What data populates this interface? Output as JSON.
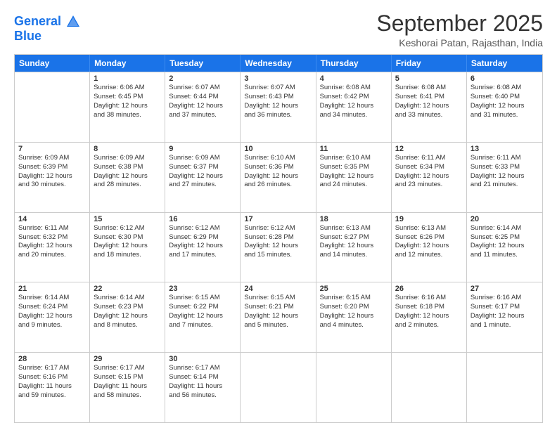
{
  "logo": {
    "line1": "General",
    "line2": "Blue"
  },
  "title": "September 2025",
  "subtitle": "Keshorai Patan, Rajasthan, India",
  "headers": [
    "Sunday",
    "Monday",
    "Tuesday",
    "Wednesday",
    "Thursday",
    "Friday",
    "Saturday"
  ],
  "rows": [
    [
      {
        "day": "",
        "lines": []
      },
      {
        "day": "1",
        "lines": [
          "Sunrise: 6:06 AM",
          "Sunset: 6:45 PM",
          "Daylight: 12 hours",
          "and 38 minutes."
        ]
      },
      {
        "day": "2",
        "lines": [
          "Sunrise: 6:07 AM",
          "Sunset: 6:44 PM",
          "Daylight: 12 hours",
          "and 37 minutes."
        ]
      },
      {
        "day": "3",
        "lines": [
          "Sunrise: 6:07 AM",
          "Sunset: 6:43 PM",
          "Daylight: 12 hours",
          "and 36 minutes."
        ]
      },
      {
        "day": "4",
        "lines": [
          "Sunrise: 6:08 AM",
          "Sunset: 6:42 PM",
          "Daylight: 12 hours",
          "and 34 minutes."
        ]
      },
      {
        "day": "5",
        "lines": [
          "Sunrise: 6:08 AM",
          "Sunset: 6:41 PM",
          "Daylight: 12 hours",
          "and 33 minutes."
        ]
      },
      {
        "day": "6",
        "lines": [
          "Sunrise: 6:08 AM",
          "Sunset: 6:40 PM",
          "Daylight: 12 hours",
          "and 31 minutes."
        ]
      }
    ],
    [
      {
        "day": "7",
        "lines": [
          "Sunrise: 6:09 AM",
          "Sunset: 6:39 PM",
          "Daylight: 12 hours",
          "and 30 minutes."
        ]
      },
      {
        "day": "8",
        "lines": [
          "Sunrise: 6:09 AM",
          "Sunset: 6:38 PM",
          "Daylight: 12 hours",
          "and 28 minutes."
        ]
      },
      {
        "day": "9",
        "lines": [
          "Sunrise: 6:09 AM",
          "Sunset: 6:37 PM",
          "Daylight: 12 hours",
          "and 27 minutes."
        ]
      },
      {
        "day": "10",
        "lines": [
          "Sunrise: 6:10 AM",
          "Sunset: 6:36 PM",
          "Daylight: 12 hours",
          "and 26 minutes."
        ]
      },
      {
        "day": "11",
        "lines": [
          "Sunrise: 6:10 AM",
          "Sunset: 6:35 PM",
          "Daylight: 12 hours",
          "and 24 minutes."
        ]
      },
      {
        "day": "12",
        "lines": [
          "Sunrise: 6:11 AM",
          "Sunset: 6:34 PM",
          "Daylight: 12 hours",
          "and 23 minutes."
        ]
      },
      {
        "day": "13",
        "lines": [
          "Sunrise: 6:11 AM",
          "Sunset: 6:33 PM",
          "Daylight: 12 hours",
          "and 21 minutes."
        ]
      }
    ],
    [
      {
        "day": "14",
        "lines": [
          "Sunrise: 6:11 AM",
          "Sunset: 6:32 PM",
          "Daylight: 12 hours",
          "and 20 minutes."
        ]
      },
      {
        "day": "15",
        "lines": [
          "Sunrise: 6:12 AM",
          "Sunset: 6:30 PM",
          "Daylight: 12 hours",
          "and 18 minutes."
        ]
      },
      {
        "day": "16",
        "lines": [
          "Sunrise: 6:12 AM",
          "Sunset: 6:29 PM",
          "Daylight: 12 hours",
          "and 17 minutes."
        ]
      },
      {
        "day": "17",
        "lines": [
          "Sunrise: 6:12 AM",
          "Sunset: 6:28 PM",
          "Daylight: 12 hours",
          "and 15 minutes."
        ]
      },
      {
        "day": "18",
        "lines": [
          "Sunrise: 6:13 AM",
          "Sunset: 6:27 PM",
          "Daylight: 12 hours",
          "and 14 minutes."
        ]
      },
      {
        "day": "19",
        "lines": [
          "Sunrise: 6:13 AM",
          "Sunset: 6:26 PM",
          "Daylight: 12 hours",
          "and 12 minutes."
        ]
      },
      {
        "day": "20",
        "lines": [
          "Sunrise: 6:14 AM",
          "Sunset: 6:25 PM",
          "Daylight: 12 hours",
          "and 11 minutes."
        ]
      }
    ],
    [
      {
        "day": "21",
        "lines": [
          "Sunrise: 6:14 AM",
          "Sunset: 6:24 PM",
          "Daylight: 12 hours",
          "and 9 minutes."
        ]
      },
      {
        "day": "22",
        "lines": [
          "Sunrise: 6:14 AM",
          "Sunset: 6:23 PM",
          "Daylight: 12 hours",
          "and 8 minutes."
        ]
      },
      {
        "day": "23",
        "lines": [
          "Sunrise: 6:15 AM",
          "Sunset: 6:22 PM",
          "Daylight: 12 hours",
          "and 7 minutes."
        ]
      },
      {
        "day": "24",
        "lines": [
          "Sunrise: 6:15 AM",
          "Sunset: 6:21 PM",
          "Daylight: 12 hours",
          "and 5 minutes."
        ]
      },
      {
        "day": "25",
        "lines": [
          "Sunrise: 6:15 AM",
          "Sunset: 6:20 PM",
          "Daylight: 12 hours",
          "and 4 minutes."
        ]
      },
      {
        "day": "26",
        "lines": [
          "Sunrise: 6:16 AM",
          "Sunset: 6:18 PM",
          "Daylight: 12 hours",
          "and 2 minutes."
        ]
      },
      {
        "day": "27",
        "lines": [
          "Sunrise: 6:16 AM",
          "Sunset: 6:17 PM",
          "Daylight: 12 hours",
          "and 1 minute."
        ]
      }
    ],
    [
      {
        "day": "28",
        "lines": [
          "Sunrise: 6:17 AM",
          "Sunset: 6:16 PM",
          "Daylight: 11 hours",
          "and 59 minutes."
        ]
      },
      {
        "day": "29",
        "lines": [
          "Sunrise: 6:17 AM",
          "Sunset: 6:15 PM",
          "Daylight: 11 hours",
          "and 58 minutes."
        ]
      },
      {
        "day": "30",
        "lines": [
          "Sunrise: 6:17 AM",
          "Sunset: 6:14 PM",
          "Daylight: 11 hours",
          "and 56 minutes."
        ]
      },
      {
        "day": "",
        "lines": []
      },
      {
        "day": "",
        "lines": []
      },
      {
        "day": "",
        "lines": []
      },
      {
        "day": "",
        "lines": []
      }
    ]
  ]
}
